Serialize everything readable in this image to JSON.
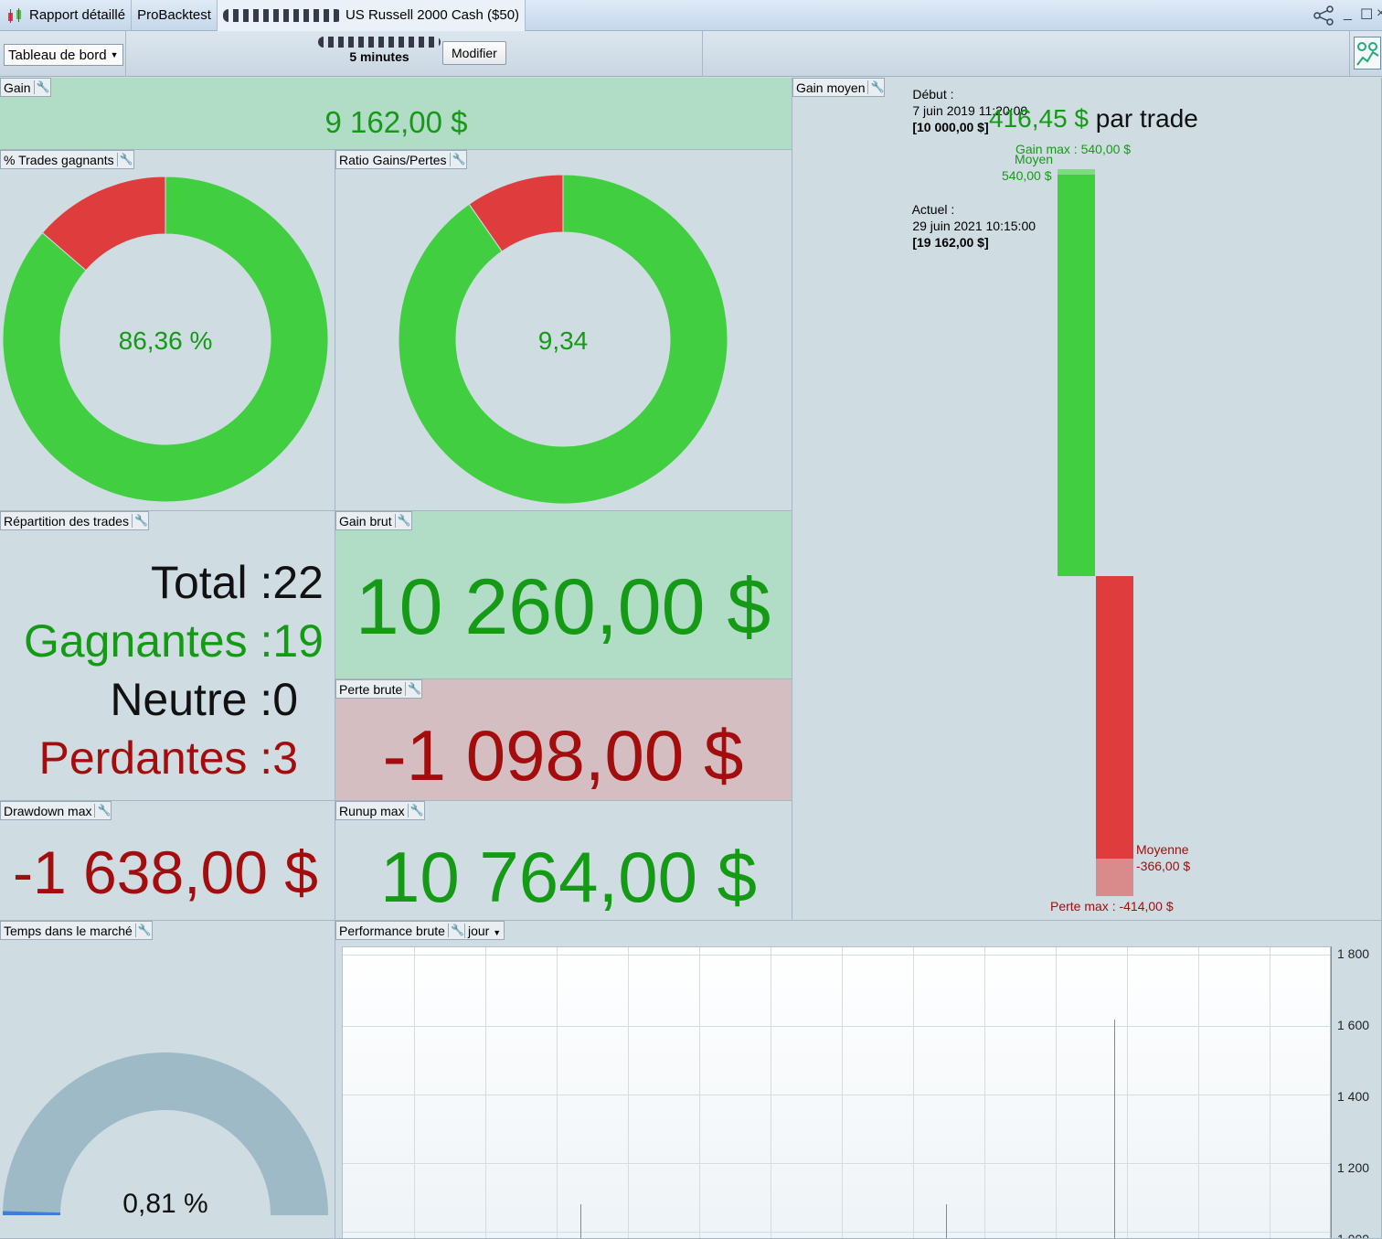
{
  "titlebar": {
    "tab_report": "Rapport détaillé",
    "tab_backtest": "ProBacktest",
    "instrument": "US Russell 2000 Cash ($50)"
  },
  "toolbar": {
    "dashboard_select": "Tableau de bord",
    "timeframe": "5 minutes",
    "modify_button": "Modifier",
    "start_label": "Début :",
    "start_date": "7 juin 2019 11:20:00",
    "start_capital": "[10 000,00 $]",
    "current_label": "Actuel :",
    "current_date": "29 juin 2021 10:15:00",
    "current_capital": "[19 162,00 $]"
  },
  "gain": {
    "title": "Gain",
    "value": "9 162,00 $"
  },
  "win_rate": {
    "title": "% Trades gagnants",
    "value": "86,36 %",
    "fraction": 0.8636
  },
  "ratio": {
    "title": "Ratio Gains/Pertes",
    "value": "9,34",
    "fraction": 0.9033
  },
  "distribution": {
    "title": "Répartition des trades",
    "total_label": "Total :",
    "total": "22",
    "win_label": "Gagnantes :",
    "win": "19",
    "neutral_label": "Neutre :",
    "neutral": "0",
    "loss_label": "Perdantes :",
    "loss": "3"
  },
  "gross_gain": {
    "title": "Gain brut",
    "value": "10 260,00 $"
  },
  "gross_loss": {
    "title": "Perte brute",
    "value": "-1 098,00 $"
  },
  "drawdown": {
    "title": "Drawdown max",
    "value": "-1 638,00 $"
  },
  "runup": {
    "title": "Runup max",
    "value": "10 764,00 $"
  },
  "avg_gain": {
    "title": "Gain moyen",
    "value": "416,45 $",
    "suffix": "par trade",
    "max_gain_label": "Gain max : 540,00 $",
    "avg_win_label": "Moyen",
    "avg_win_value": "540,00 $",
    "avg_loss_label": "Moyenne",
    "avg_loss_value": "-366,00 $",
    "max_loss_label": "Perte max : -414,00 $",
    "max_gain": 540,
    "avg_win": 540,
    "avg_loss": -366,
    "max_loss": -414
  },
  "time_in_market": {
    "title": "Temps dans le marché",
    "value": "0,81 %",
    "fraction": 0.0081
  },
  "performance": {
    "title": "Performance brute",
    "period_select": "jour",
    "ticks": [
      "1 800",
      "1 600",
      "1 400",
      "1 200",
      "1 000"
    ]
  },
  "colors": {
    "green": "#41cf41",
    "red": "#df3d3d",
    "text_green": "#159a15",
    "text_red": "#a30d0d"
  },
  "chart_data": {
    "type": "bar",
    "y_ticks": [
      1800,
      1600,
      1400,
      1200,
      1000
    ],
    "ylim": [
      950,
      1830
    ],
    "bars": [
      {
        "x": 0.24,
        "value": 1080
      },
      {
        "x": 0.61,
        "value": 1082
      },
      {
        "x": 0.78,
        "value": 1620
      }
    ]
  }
}
